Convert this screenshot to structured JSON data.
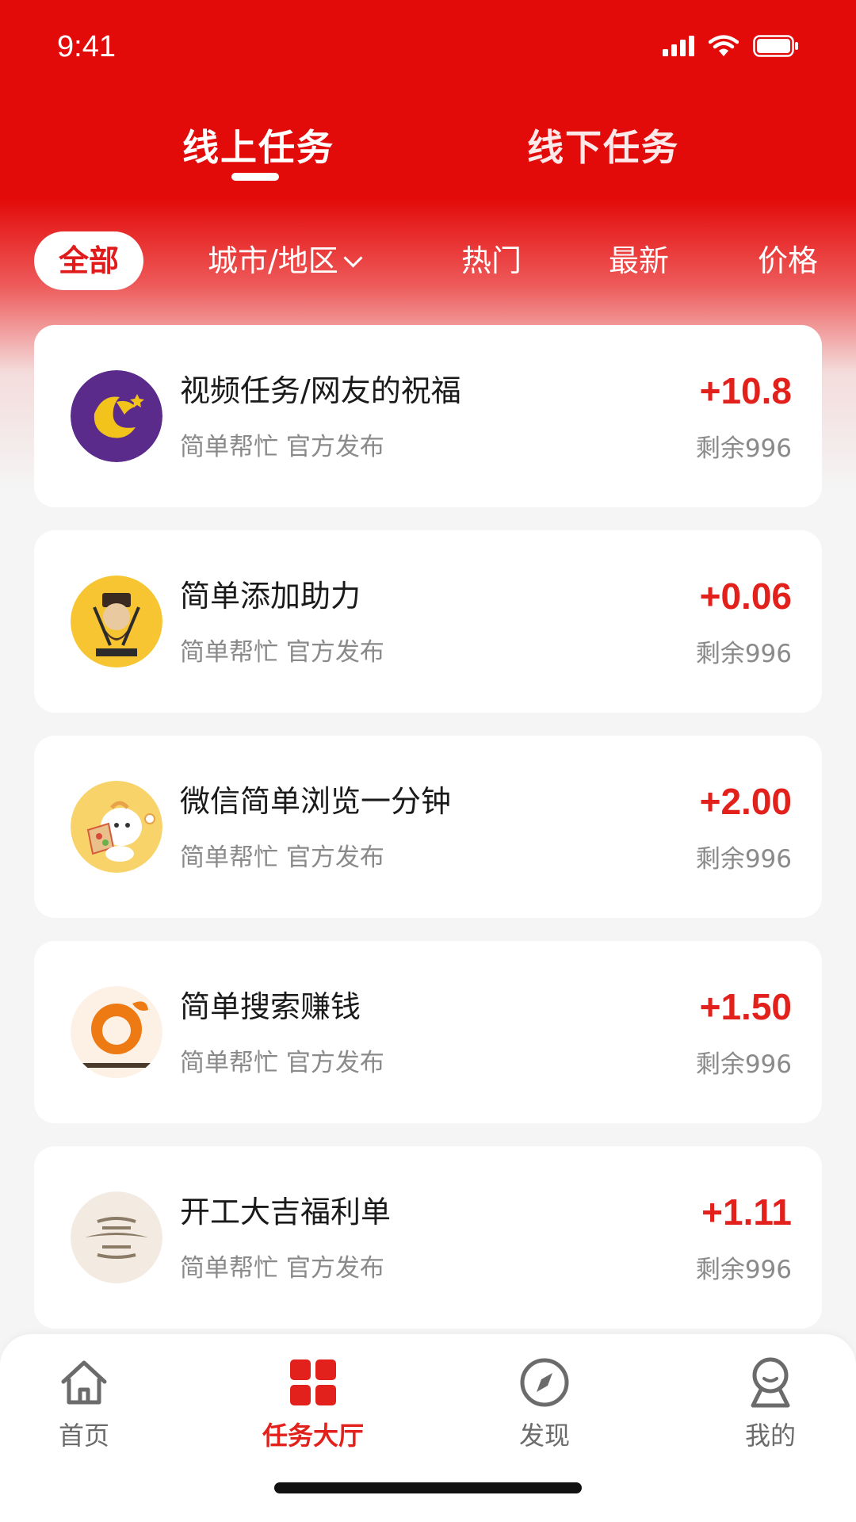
{
  "status_bar": {
    "time": "9:41"
  },
  "tabs": [
    {
      "label": "线上任务",
      "active": true
    },
    {
      "label": "线下任务",
      "active": false
    }
  ],
  "filters": {
    "all": "全部",
    "city": "城市/地区",
    "hot": "热门",
    "newest": "最新",
    "price": "价格"
  },
  "tasks": [
    {
      "title": "视频任务/网友的祝福",
      "subtitle": "简单帮忙 官方发布",
      "reward": "+10.8",
      "remaining": "剩余996"
    },
    {
      "title": "简单添加助力",
      "subtitle": "简单帮忙 官方发布",
      "reward": "+0.06",
      "remaining": "剩余996"
    },
    {
      "title": "微信简单浏览一分钟",
      "subtitle": "简单帮忙 官方发布",
      "reward": "+2.00",
      "remaining": "剩余996"
    },
    {
      "title": "简单搜索赚钱",
      "subtitle": "简单帮忙 官方发布",
      "reward": "+1.50",
      "remaining": "剩余996"
    },
    {
      "title": "开工大吉福利单",
      "subtitle": "简单帮忙 官方发布",
      "reward": "+1.11",
      "remaining": "剩余996"
    }
  ],
  "bottom_nav": [
    {
      "label": "首页",
      "icon": "home-icon",
      "active": false
    },
    {
      "label": "任务大厅",
      "icon": "grid-icon",
      "active": true
    },
    {
      "label": "发现",
      "icon": "compass-icon",
      "active": false
    },
    {
      "label": "我的",
      "icon": "profile-icon",
      "active": false
    }
  ],
  "colors": {
    "brand_red": "#e30a0a",
    "price_red": "#e3211c"
  }
}
